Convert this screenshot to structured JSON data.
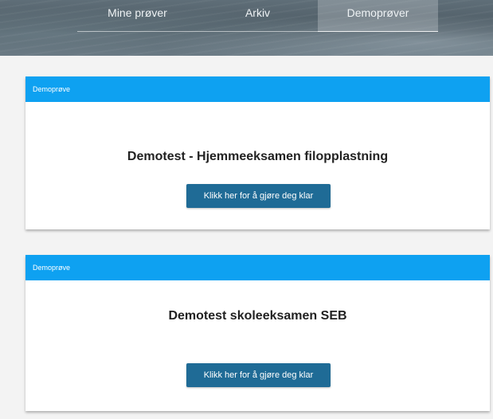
{
  "nav": {
    "tabs": [
      {
        "label": "Mine prøver",
        "active": false
      },
      {
        "label": "Arkiv",
        "active": false
      },
      {
        "label": "Demoprøver",
        "active": true
      }
    ]
  },
  "cards": [
    {
      "header": "Demoprøve",
      "title": "Demotest - Hjemmeeksamen filopplastning",
      "button_label": "Klikk her for å gjøre deg klar"
    },
    {
      "header": "Demoprøve",
      "title": "Demotest skoleeksamen SEB",
      "button_label": "Klikk her for å gjøre deg klar"
    }
  ],
  "colors": {
    "header_blue": "#0ea1f1",
    "button_blue": "#1f6b96",
    "page_bg": "#f3f3f3"
  }
}
